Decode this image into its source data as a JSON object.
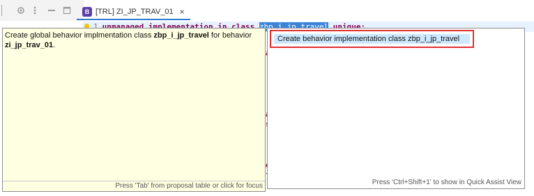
{
  "toolbar": {
    "icons": [
      "pin-icon",
      "view-menu-icon",
      "minimize-icon",
      "maximize-icon"
    ]
  },
  "tab": {
    "title": "[TRL] ZI_JP_TRAV_01",
    "icon_letter": "B",
    "close": "×"
  },
  "editor": {
    "line_number": "1",
    "kw_unmanaged": "unmanaged",
    "kw_implementation": "implementation",
    "kw_in": "in",
    "kw_class": "class",
    "selected_class": "zbp_i_jp_travel",
    "kw_unique": "unique;",
    "fragments": [
      "a",
      "a",
      "s",
      "e",
      "f"
    ]
  },
  "detail": {
    "text_pre": "Create global behavior implmentation class ",
    "class_name": "zbp_i_jp_travel",
    "text_mid": " for behavior ",
    "behavior_name": "zi_jp_trav_01",
    "text_end": ".",
    "footer": "Press 'Tab' from proposal table or click for focus"
  },
  "proposals": {
    "items": [
      {
        "label": "Create behavior implementation class zbp_i_jp_travel"
      }
    ],
    "footer": "Press 'Ctrl+Shift+1' to show in Quick Assist View"
  }
}
